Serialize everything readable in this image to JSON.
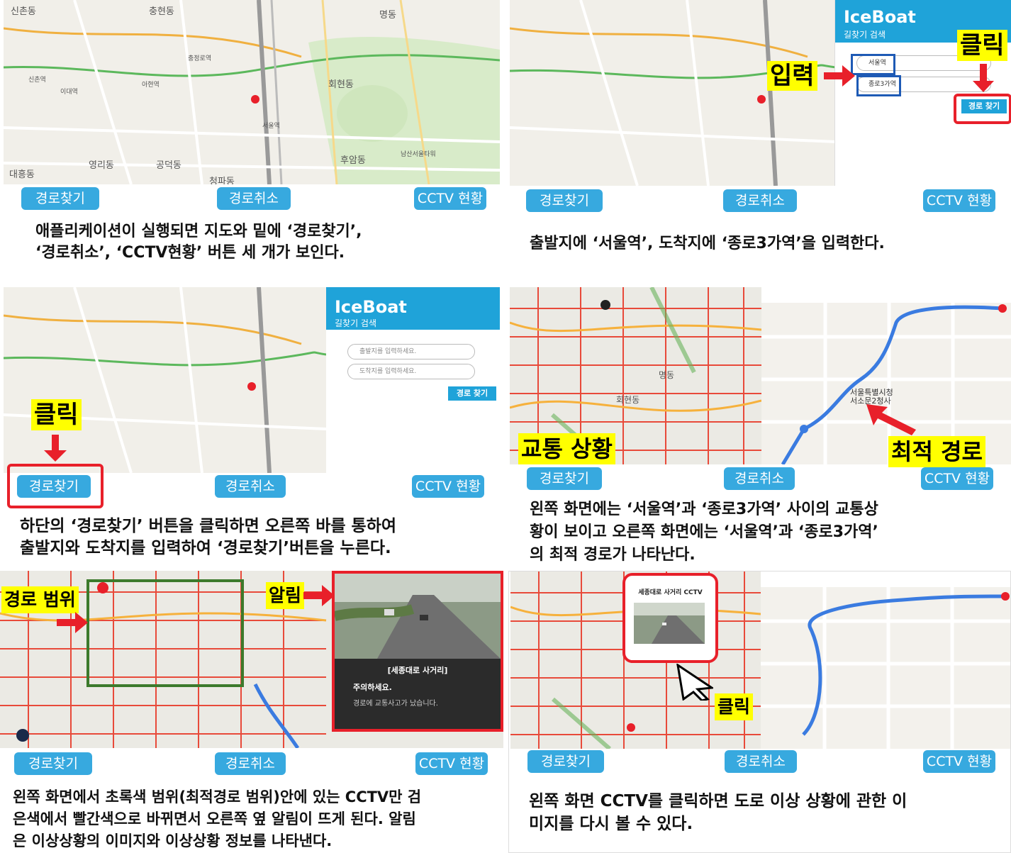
{
  "buttons": {
    "find_route": "경로찾기",
    "cancel_route": "경로취소",
    "cctv_status": "CCTV 현황"
  },
  "app": {
    "name": "IceBoat",
    "subtitle": "길찾기 검색",
    "find_button": "경로 찾기"
  },
  "panel1": {
    "map_labels": [
      "신촌동",
      "충현동",
      "신촌역",
      "이대역",
      "아현역",
      "충정로역",
      "서울역",
      "명동",
      "회현동",
      "후암동",
      "남산서울타워",
      "공덕동",
      "청파동",
      "영리동",
      "대흥동"
    ],
    "caption": [
      "애플리케이션이 실행되면 지도와 밑에 ‘경로찾기’,",
      "‘경로취소’, ‘CCTV현황’ 버튼 세 개가 보인다."
    ]
  },
  "panel2": {
    "origin_value": "서울역",
    "dest_value": "종로3가역",
    "input_label": "입력",
    "click_label": "클릭",
    "caption": [
      "출발지에 ‘서울역’, 도착지에 ‘종로3가역’을 입력한다."
    ]
  },
  "panel3": {
    "origin_placeholder": "출발지를 입력하세요.",
    "dest_placeholder": "도착지를 입력하세요.",
    "click_label": "클릭",
    "caption": [
      "하단의 ‘경로찾기’ 버튼을 클릭하면 오른쪽 바를 통하여",
      "출발지와 도착지를 입력하여 ‘경로찾기’버튼을 누른다."
    ]
  },
  "panel4": {
    "traffic_label": "교통 상황",
    "route_label": "최적 경로",
    "map_labels": [
      "서울특별시청",
      "서소문2청사",
      "명동",
      "회현동"
    ],
    "caption": [
      "왼쪽 화면에는 ‘서울역’과 ‘종로3가역’ 사이의 교통상",
      "황이 보이고 오른쪽 화면에는 ‘서울역’과 ‘종로3가역’",
      "의 최적 경로가 나타난다."
    ]
  },
  "panel5": {
    "range_label": "경로 범위",
    "alert_label": "알림",
    "alert_title": "[세종대로 사거리]",
    "alert_heading": "주의하세요.",
    "alert_message": "경로에 교통사고가 났습니다.",
    "caption": [
      "왼쪽 화면에서 초록색 범위(최적경로 범위)안에 있는 CCTV만 검",
      "은색에서 빨간색으로 바뀌면서 오른쪽 옆 알림이 뜨게 된다. 알림",
      "은 이상상황의 이미지와 이상상황 정보를 나타낸다."
    ]
  },
  "panel6": {
    "popup_title": "세종대로 사거리 CCTV",
    "click_label": "클릭",
    "caption": [
      "왼쪽 화면 CCTV를 클릭하면 도로 이상 상황에 관한 이",
      "미지를 다시 볼 수 있다."
    ]
  },
  "colors": {
    "button": "#37a9df",
    "highlight": "#ffff00",
    "red": "#e8202a",
    "green_box": "#3c7a2c",
    "app_blue": "#1fa3d9"
  }
}
